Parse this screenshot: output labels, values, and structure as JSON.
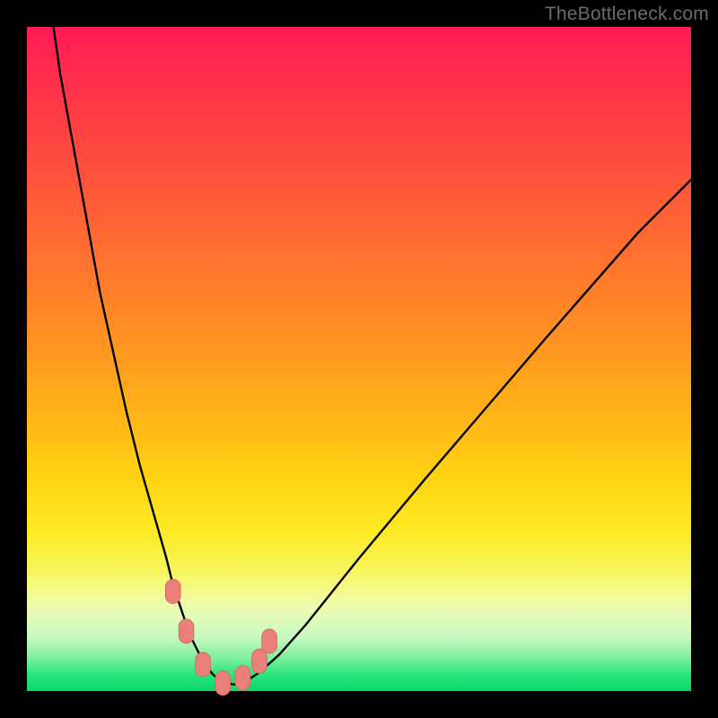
{
  "watermark": "TheBottleneck.com",
  "colors": {
    "curve_stroke": "#000000",
    "marker_fill": "#e98079",
    "marker_stroke": "#d46a63",
    "gradient_top": "#ff1955",
    "gradient_bottom": "#07d96a"
  },
  "chart_data": {
    "type": "line",
    "title": "",
    "xlabel": "",
    "ylabel": "",
    "xlim": [
      0,
      100
    ],
    "ylim": [
      0,
      100
    ],
    "note": "Axes are unlabeled; values are percent of plot width/height estimated from pixels. y=0 is bottom, y=100 is top.",
    "series": [
      {
        "name": "bottleneck-curve",
        "x": [
          4,
          5,
          7,
          9,
          11,
          13,
          15,
          17,
          19,
          21,
          22,
          23,
          24,
          25,
          26,
          27,
          28,
          29,
          30,
          31,
          32,
          33,
          35,
          38,
          42,
          46,
          50,
          55,
          60,
          66,
          72,
          78,
          85,
          92,
          100
        ],
        "y": [
          100,
          93,
          82,
          71,
          60,
          51,
          42,
          34,
          27,
          20,
          16,
          13,
          10,
          7.5,
          5.5,
          3.8,
          2.5,
          1.7,
          1.2,
          1.0,
          1.1,
          1.5,
          2.8,
          5.5,
          10,
          15,
          20,
          26,
          32,
          39,
          46,
          53,
          61,
          69,
          77
        ]
      }
    ],
    "markers": {
      "name": "highlight-markers",
      "points": [
        {
          "x": 22.0,
          "y": 15.0
        },
        {
          "x": 24.0,
          "y": 9.0
        },
        {
          "x": 26.5,
          "y": 4.0
        },
        {
          "x": 29.5,
          "y": 1.2
        },
        {
          "x": 32.5,
          "y": 2.0
        },
        {
          "x": 35.0,
          "y": 4.5
        },
        {
          "x": 36.5,
          "y": 7.5
        }
      ],
      "radius_percent": 1.4
    }
  }
}
